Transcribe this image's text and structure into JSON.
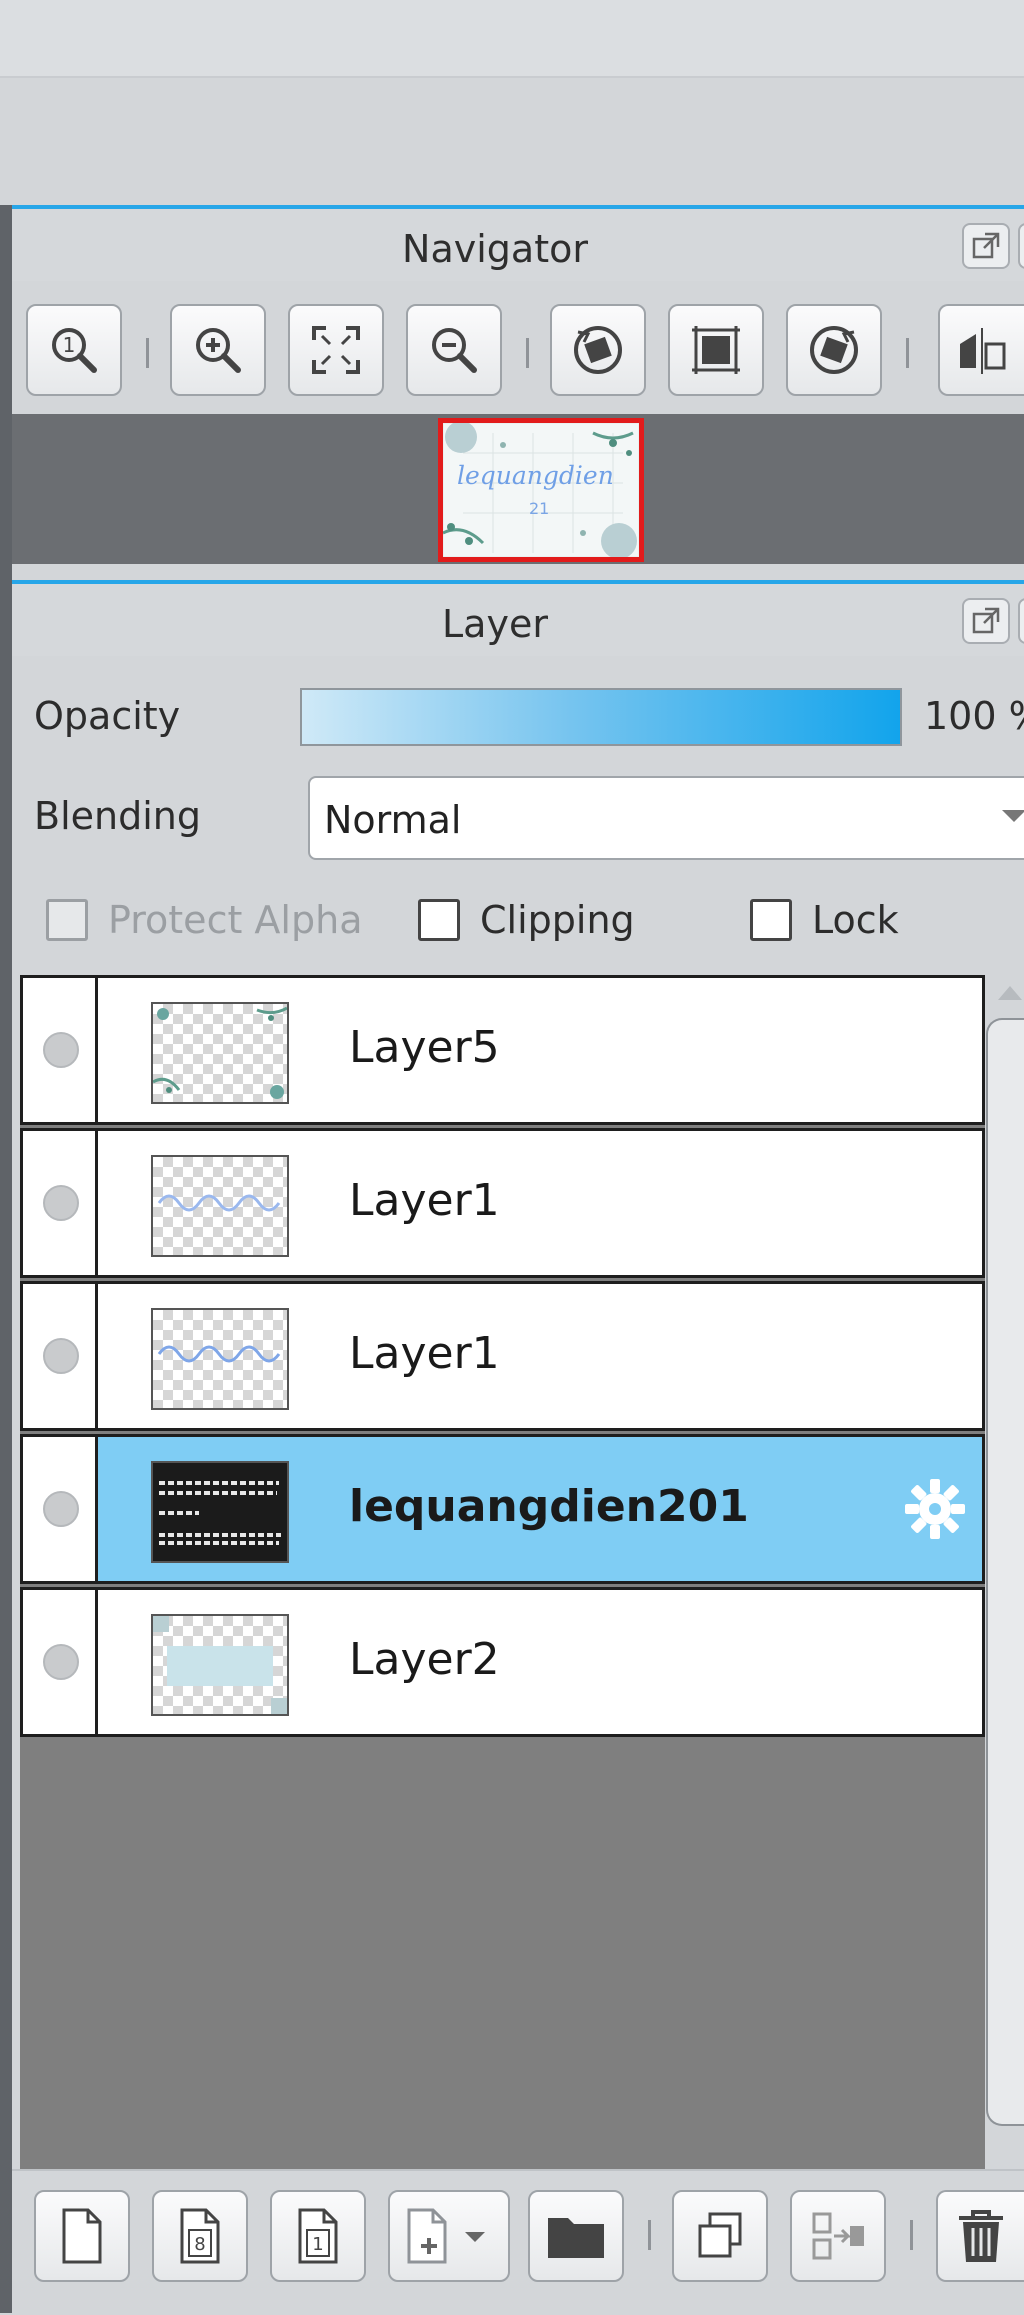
{
  "navigator": {
    "title": "Navigator",
    "toolbar": [
      {
        "icon": "zoom-actual-size-icon"
      },
      {
        "icon": "zoom-in-icon"
      },
      {
        "icon": "fit-to-window-icon"
      },
      {
        "icon": "zoom-out-icon"
      },
      {
        "icon": "rotate-left-icon"
      },
      {
        "icon": "reset-view-icon"
      },
      {
        "icon": "rotate-right-icon"
      },
      {
        "icon": "flip-horizontal-icon"
      }
    ],
    "preview": {
      "script_text": "lequangdien",
      "number_text": "21"
    }
  },
  "layer_panel": {
    "title": "Layer",
    "opacity_label": "Opacity",
    "opacity_value": "100 %",
    "opacity_level": 1.0,
    "blending_label": "Blending",
    "blending_value": "Normal",
    "checkboxes": {
      "protect_alpha": {
        "label": "Protect Alpha",
        "checked": false,
        "enabled": false
      },
      "clipping": {
        "label": "Clipping",
        "checked": false,
        "enabled": true
      },
      "lock": {
        "label": "Lock",
        "checked": false,
        "enabled": true
      }
    },
    "layers": [
      {
        "name": "Layer5",
        "selected": false
      },
      {
        "name": "Layer1",
        "selected": false
      },
      {
        "name": "Layer1",
        "selected": false
      },
      {
        "name": "lequangdien201",
        "selected": true
      },
      {
        "name": "Layer2",
        "selected": false
      }
    ],
    "bottom_toolbar": [
      {
        "icon": "new-layer-icon"
      },
      {
        "icon": "new-8bit-layer-icon"
      },
      {
        "icon": "new-1bit-layer-icon"
      },
      {
        "icon": "add-layer-menu-icon"
      },
      {
        "icon": "new-folder-icon"
      },
      {
        "icon": "duplicate-layer-icon"
      },
      {
        "icon": "merge-down-icon"
      },
      {
        "icon": "delete-layer-icon"
      }
    ]
  },
  "colors": {
    "accent": "#27a6e8",
    "selection": "#7fcdf4",
    "preview_border": "#e21b1b"
  }
}
